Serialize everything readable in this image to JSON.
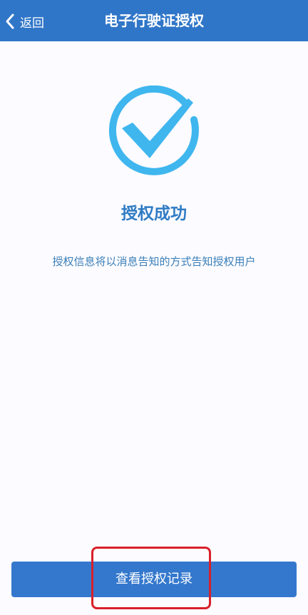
{
  "header": {
    "back_label": "返回",
    "title": "电子行驶证授权"
  },
  "result": {
    "icon": "check-circle-icon",
    "title": "授权成功",
    "description": "授权信息将以消息告知的方式告知授权用户"
  },
  "actions": {
    "view_records_label": "查看授权记录"
  },
  "colors": {
    "header_bg": "#3076c8",
    "accent": "#2f7bc4",
    "icon": "#3fb6ee",
    "button_bg": "#3478cd",
    "highlight": "#d9202a"
  }
}
